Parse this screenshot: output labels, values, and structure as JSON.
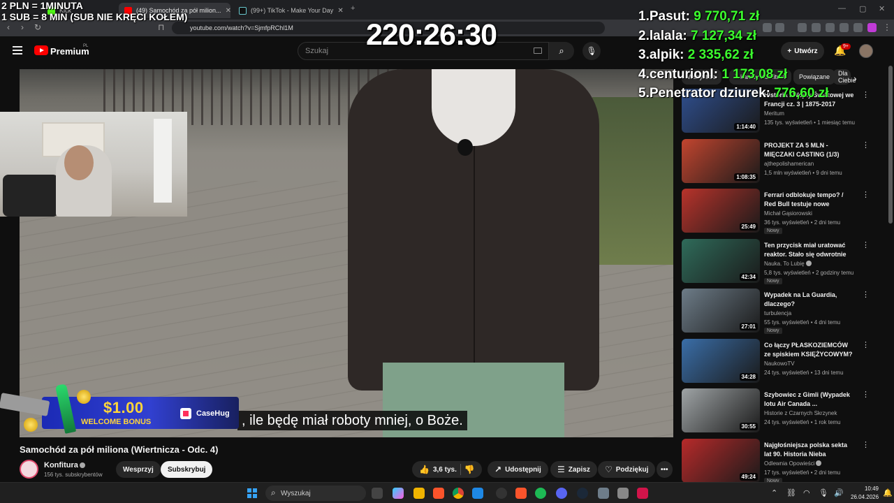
{
  "browser": {
    "tabs": [
      {
        "label": "Kick",
        "active": false
      },
      {
        "label": "(49) Samochód za pół milion...",
        "active": true
      },
      {
        "label": "(99+) TikTok - Make Your Day",
        "active": false
      }
    ],
    "new_tab": "+",
    "url": "youtube.com/watch?v=SjmfpRChl1M"
  },
  "stream_overlay": {
    "promo_line1": "2 PLN =  1MINUTA",
    "promo_line2": "1 SUB = 8 MIN (SUB NIE KRĘCI KOŁEM)",
    "timer": "220:26:30",
    "leaderboard": [
      {
        "rank": "1.",
        "name": "Pasut:",
        "amount": "9 770,71 zł"
      },
      {
        "rank": "2.",
        "name": "lalala:",
        "amount": "7 127,34 zł"
      },
      {
        "rank": "3.",
        "name": "alpik:",
        "amount": "2 335,62 zł"
      },
      {
        "rank": "4.",
        "name": "centurionl:",
        "amount": "1 173,08 zł"
      },
      {
        "rank": "5.",
        "name": "Penetrator dziurek:",
        "amount": "776,60 zł"
      }
    ],
    "ad_amount": "$1.00",
    "ad_bonus": "WELCOME BONUS",
    "ad_brand": "CaseHug"
  },
  "youtube": {
    "brand": "Premium",
    "region": "PL",
    "search_placeholder": "Szukaj",
    "create_label": "Utwórz",
    "notifications": "9+",
    "subtitle": ", ile będę miał roboty mniej, o Boże.",
    "video_title": "Samochód za pół miliona (Wiertnicza - Odc. 4)",
    "channel_name": "Konfitura",
    "channel_subs": "156 tys. subskrybentów",
    "buttons": {
      "support": "Wesprzyj",
      "subscribe": "Subskrybuj",
      "likes": "3,6 tys.",
      "share": "Udostępnij",
      "save": "Zapisz",
      "thanks": "Podziękuj",
      "more": "•••"
    },
    "chips": [
      "Wszystkie",
      "Z kanału Konfitura",
      "Powiązane",
      "Dla Ciebie"
    ],
    "recommendations": [
      {
        "title": "Historia I Wojny Światowej we Francji cz. 3 | 1875-2017",
        "channel": "Meritum",
        "verified": false,
        "meta": "135 tys. wyświetleń • 1 miesiąc temu",
        "duration": "1:14:40",
        "new": "",
        "thumb_color": "#2f4f8f"
      },
      {
        "title": "PROJEKT ZA 5 MLN - MIĘCZAKI CASTING (1/3)",
        "channel": "ajthepolishamerican",
        "verified": false,
        "meta": "1,5 mln wyświetleń • 9 dni temu",
        "duration": "1:08:35",
        "new": "",
        "thumb_color": "#c2452f"
      },
      {
        "title": "Ferrari odblokuje tempo? / Red Bull testuje nowe skrzydło / ...",
        "channel": "Michał Gąsiorowski",
        "verified": false,
        "meta": "36 tys. wyświetleń • 2 dni temu",
        "duration": "25:49",
        "new": "Nowy",
        "thumb_color": "#b8332b"
      },
      {
        "title": "Ten przycisk miał uratować reaktor. Stało się odwrotnie",
        "channel": "Nauka. To Lubię",
        "verified": true,
        "meta": "5,8 tys. wyświetleń • 2 godziny temu",
        "duration": "42:34",
        "new": "Nowy",
        "thumb_color": "#2f6b5a"
      },
      {
        "title": "Wypadek na La Guardia, dlaczego?",
        "channel": "turbulencja",
        "verified": false,
        "meta": "55 tys. wyświetleń • 4 dni temu",
        "duration": "27:01",
        "new": "Nowy",
        "thumb_color": "#6d7c88"
      },
      {
        "title": "Co łączy PŁASKOZIEMCÓW ze spiskiem KSIĘŻYCOWYM? ...",
        "channel": "NaukowoTV",
        "verified": false,
        "meta": "24 tys. wyświetleń • 13 dni temu",
        "duration": "34:28",
        "new": "",
        "thumb_color": "#3a6ea8"
      },
      {
        "title": "Szybowiec z Gimli (Wypadek lotu Air Canada ...",
        "channel": "Historie z Czarnych Skrzynek",
        "verified": false,
        "meta": "24 tys. wyświetleń • 1 rok temu",
        "duration": "30:55",
        "new": "",
        "thumb_color": "#9fa4a6"
      },
      {
        "title": "Najgłośniejsza polska sekta lat 90. Historia Nieba",
        "channel": "Odlewnia Opowieści",
        "verified": true,
        "meta": "17 tys. wyświetleń • 2 dni temu",
        "duration": "49:24",
        "new": "Nowy",
        "thumb_color": "#b72a2a"
      }
    ]
  },
  "taskbar": {
    "search_placeholder": "Wyszukaj",
    "time": "10:49",
    "date": "26.04.2026"
  },
  "colors": {
    "youtube_red": "#ff0000",
    "leaderboard_amount": "#3cff2e",
    "ad_yellow": "#ffd53a"
  }
}
